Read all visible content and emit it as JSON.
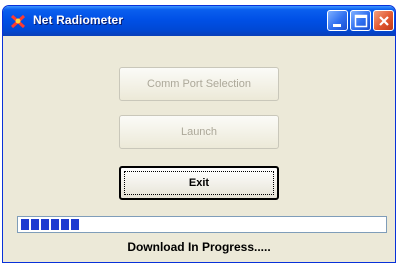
{
  "window": {
    "title": "Net Radiometer",
    "icon": "net-radiometer-app-icon"
  },
  "titlebar_buttons": {
    "minimize_icon": "minimize-icon",
    "maximize_icon": "maximize-icon",
    "close_icon": "close-icon"
  },
  "buttons": {
    "comm_port_label": "Comm Port Selection",
    "launch_label": "Launch",
    "exit_label": "Exit"
  },
  "progress": {
    "fraction": 0.17,
    "color": "#1d3bd0"
  },
  "status": {
    "text": "Download In Progress....."
  }
}
